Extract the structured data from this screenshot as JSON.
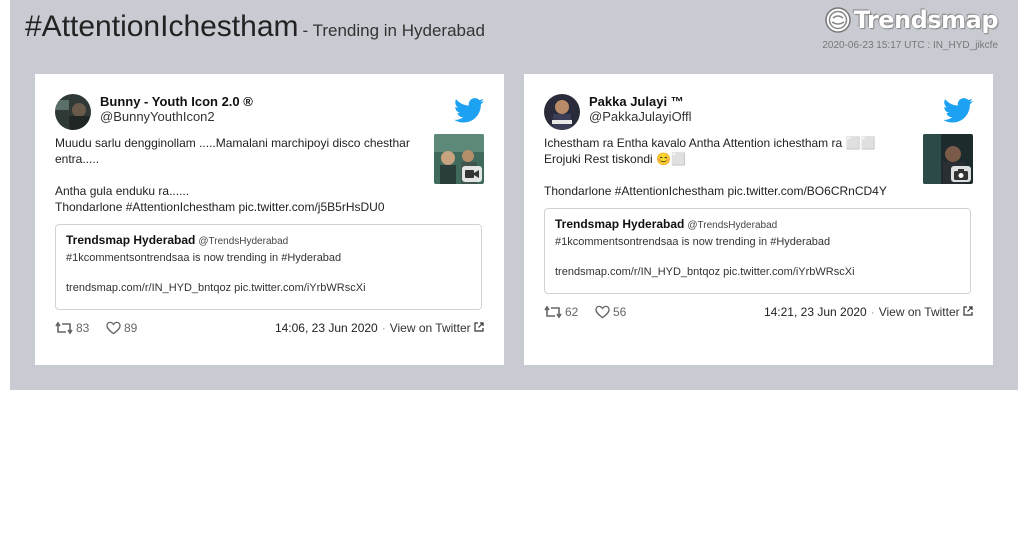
{
  "header": {
    "title": "#AttentionIchestham",
    "subtitle": "- Trending in Hyderabad",
    "logo_text": "Trendsmap",
    "stamp": "2020-06-23 15:17 UTC : IN_HYD_jikcfe"
  },
  "colors": {
    "panel": "#c9cbd2",
    "twitter_blue": "#1da1f2",
    "card": "#ffffff"
  },
  "tweets": [
    {
      "name": "Bunny - Youth Icon 2.0 ®",
      "handle": "@BunnyYouthIcon2",
      "text": "Muudu sarlu dengginollam .....Mamalani marchipoyi disco chesthar entra.....\n\nAntha gula enduku ra......\nThondarlone #AttentionIchestham pic.twitter.com/j5B5rHsDU0",
      "media_icon": "video-camera-icon",
      "quote": {
        "name": "Trendsmap Hyderabad",
        "handle": "@TrendsHyderabad",
        "text": "#1kcommentsontrendsaa is now trending in #Hyderabad\n\ntrendsmap.com/r/IN_HYD_bntqoz pic.twitter.com/iYrbWRscXi"
      },
      "retweets": "83",
      "likes": "89",
      "time": "14:06, 23 Jun 2020",
      "view_label": "View on Twitter"
    },
    {
      "name": "Pakka Julayi ™",
      "handle": "@PakkaJulayiOffl",
      "text": "Ichestham ra Entha kavalo Antha Attention ichestham ra ⬜⬜\nErojuki Rest tiskondi 😊⬜\n\nThondarlone #AttentionIchestham pic.twitter.com/BO6CRnCD4Y",
      "media_icon": "camera-icon",
      "quote": {
        "name": "Trendsmap Hyderabad",
        "handle": "@TrendsHyderabad",
        "text": "#1kcommentsontrendsaa is now trending in #Hyderabad\n\ntrendsmap.com/r/IN_HYD_bntqoz pic.twitter.com/iYrbWRscXi"
      },
      "retweets": "62",
      "likes": "56",
      "time": "14:21, 23 Jun 2020",
      "view_label": "View on Twitter"
    }
  ]
}
